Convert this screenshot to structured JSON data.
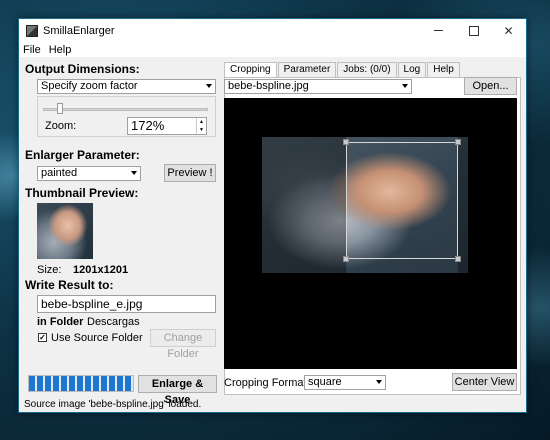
{
  "window": {
    "title": "SmillaEnlarger",
    "buttons": [
      "minimize",
      "maximize",
      "close"
    ],
    "close_symbol": "✕"
  },
  "menu": {
    "items": [
      "File",
      "Help"
    ]
  },
  "output_dimensions": {
    "heading": "Output Dimensions:",
    "mode": "Specify zoom factor",
    "zoom_label": "Zoom:",
    "zoom_value": "172%"
  },
  "enlarger_parameter": {
    "heading": "Enlarger Parameter:",
    "preset": "painted",
    "preview_label": "Preview !"
  },
  "thumbnail": {
    "heading": "Thumbnail Preview:",
    "size_label": "Size:",
    "size_value": "1201x1201"
  },
  "write_result": {
    "heading": "Write Result to:",
    "filename": "bebe-bspline_e.jpg",
    "folder_label": "in Folder",
    "folder_value": "Descargas",
    "use_source_label": "Use Source Folder",
    "use_source_checked": "✓",
    "change_folder_label": "Change Folder"
  },
  "progress": {
    "fraction": 1.0
  },
  "enlarge_label": "Enlarge & Save",
  "status": "Source image 'bebe-bspline.jpg' loaded.",
  "tabs": [
    "Cropping",
    "Parameter",
    "Jobs: (0/0)",
    "Log",
    "Help"
  ],
  "active_tab": "Cropping",
  "source_file": "bebe-bspline.jpg",
  "open_label": "Open...",
  "cropping_format_label": "Cropping Format:",
  "cropping_format_value": "square",
  "center_view_label": "Center View",
  "icons": {
    "app": "smilla-app-icon",
    "combo": "chevron-down-icon"
  }
}
